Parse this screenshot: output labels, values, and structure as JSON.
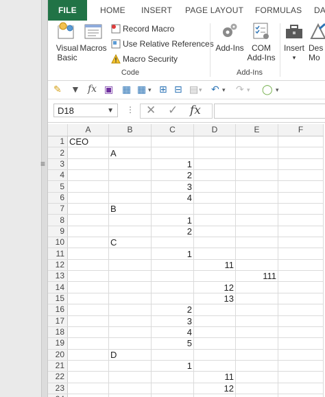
{
  "ribbon_tabs": [
    "FILE",
    "HOME",
    "INSERT",
    "PAGE LAYOUT",
    "FORMULAS",
    "DA"
  ],
  "code_group": {
    "label": "Code",
    "visual_basic": "Visual Basic",
    "macros": "Macros",
    "record_macro": "Record Macro",
    "relative_refs": "Use Relative References",
    "macro_security": "Macro Security"
  },
  "addins_group": {
    "label": "Add-Ins",
    "addins": "Add-Ins",
    "com_addins": "COM Add-Ins"
  },
  "controls_group": {
    "insert": "Insert",
    "design": "Des Mo"
  },
  "formula_bar": {
    "name_box": "D18",
    "formula": ""
  },
  "columns": [
    "A",
    "B",
    "C",
    "D",
    "E",
    "F"
  ],
  "rows": [
    {
      "n": "1",
      "A": "CEO",
      "B": "",
      "C": "",
      "D": "",
      "E": ""
    },
    {
      "n": "2",
      "A": "",
      "B": "A",
      "C": "",
      "D": "",
      "E": ""
    },
    {
      "n": "3",
      "A": "",
      "B": "",
      "C": "1",
      "D": "",
      "E": ""
    },
    {
      "n": "4",
      "A": "",
      "B": "",
      "C": "2",
      "D": "",
      "E": ""
    },
    {
      "n": "5",
      "A": "",
      "B": "",
      "C": "3",
      "D": "",
      "E": ""
    },
    {
      "n": "6",
      "A": "",
      "B": "",
      "C": "4",
      "D": "",
      "E": ""
    },
    {
      "n": "7",
      "A": "",
      "B": "B",
      "C": "",
      "D": "",
      "E": ""
    },
    {
      "n": "8",
      "A": "",
      "B": "",
      "C": "1",
      "D": "",
      "E": ""
    },
    {
      "n": "9",
      "A": "",
      "B": "",
      "C": "2",
      "D": "",
      "E": ""
    },
    {
      "n": "10",
      "A": "",
      "B": "C",
      "C": "",
      "D": "",
      "E": ""
    },
    {
      "n": "11",
      "A": "",
      "B": "",
      "C": "1",
      "D": "",
      "E": ""
    },
    {
      "n": "12",
      "A": "",
      "B": "",
      "C": "",
      "D": "11",
      "E": ""
    },
    {
      "n": "13",
      "A": "",
      "B": "",
      "C": "",
      "D": "",
      "E": "111"
    },
    {
      "n": "14",
      "A": "",
      "B": "",
      "C": "",
      "D": "12",
      "E": ""
    },
    {
      "n": "15",
      "A": "",
      "B": "",
      "C": "",
      "D": "13",
      "E": ""
    },
    {
      "n": "16",
      "A": "",
      "B": "",
      "C": "2",
      "D": "",
      "E": ""
    },
    {
      "n": "17",
      "A": "",
      "B": "",
      "C": "3",
      "D": "",
      "E": ""
    },
    {
      "n": "18",
      "A": "",
      "B": "",
      "C": "4",
      "D": "",
      "E": ""
    },
    {
      "n": "19",
      "A": "",
      "B": "",
      "C": "5",
      "D": "",
      "E": ""
    },
    {
      "n": "20",
      "A": "",
      "B": "D",
      "C": "",
      "D": "",
      "E": ""
    },
    {
      "n": "21",
      "A": "",
      "B": "",
      "C": "1",
      "D": "",
      "E": ""
    },
    {
      "n": "22",
      "A": "",
      "B": "",
      "C": "",
      "D": "11",
      "E": ""
    },
    {
      "n": "23",
      "A": "",
      "B": "",
      "C": "",
      "D": "12",
      "E": ""
    },
    {
      "n": "24",
      "A": "",
      "B": "",
      "C": "",
      "D": "",
      "E": ""
    }
  ]
}
